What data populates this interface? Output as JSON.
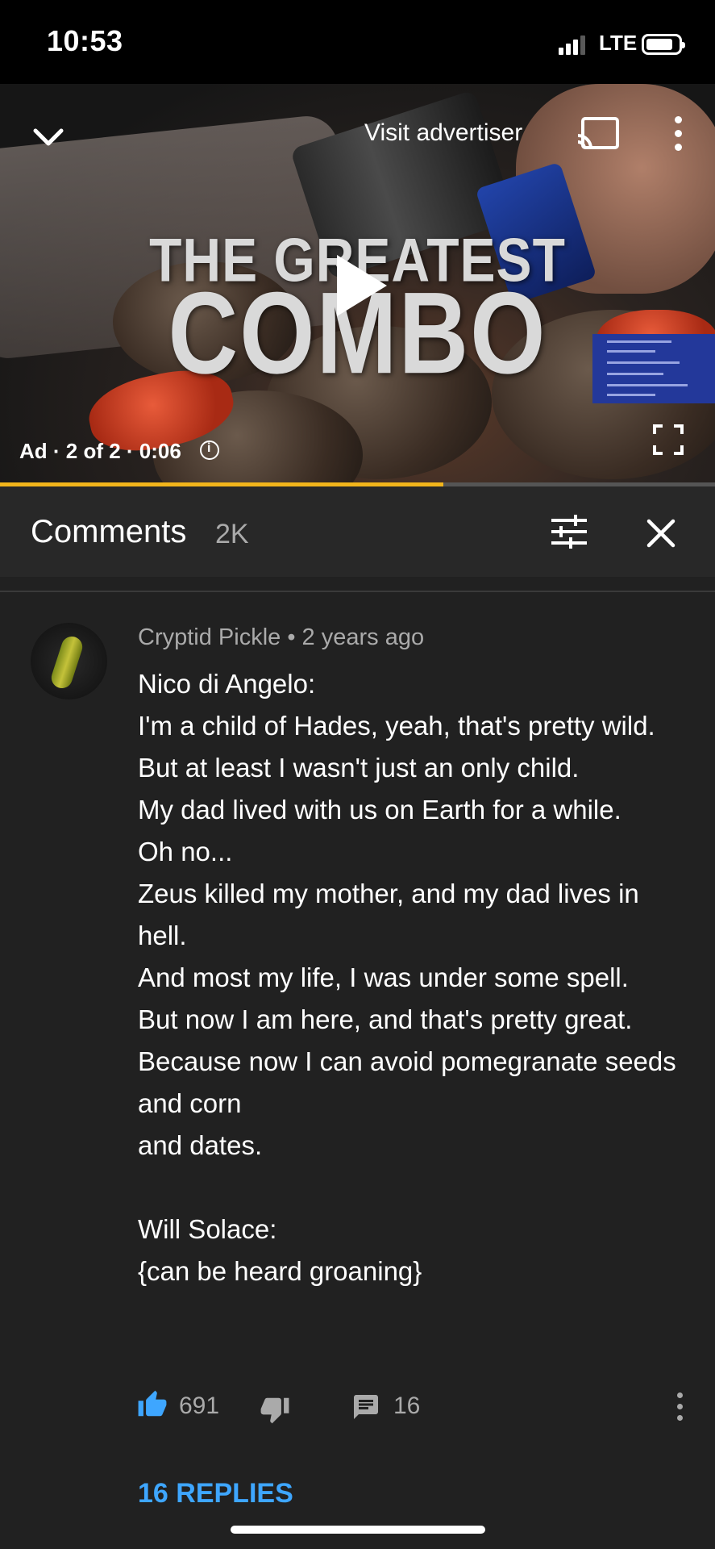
{
  "status_bar": {
    "time": "10:53",
    "network": "LTE"
  },
  "video": {
    "visit_advertiser": "Visit advertiser",
    "overlay_title_line1": "THE GREATEST",
    "overlay_title_line2": "COMBO",
    "ad_info": "Ad · 2 of 2 · 0:06",
    "progress_fraction": 0.62
  },
  "comments_header": {
    "title": "Comments",
    "count": "2K"
  },
  "comment": {
    "author": "Cryptid Pickle",
    "age": "2 years ago",
    "meta": "Cryptid Pickle • 2 years ago",
    "text": "Nico di Angelo:\nI'm a child of Hades, yeah, that's pretty wild.\nBut at least I wasn't just an only child.\nMy dad lived with us on Earth for a while.\nOh no...\nZeus killed my mother, and my dad lives in hell.\nAnd most my life, I was under some spell.\nBut now I am here, and that's pretty great.\nBecause now I can avoid pomegranate seeds\nand corn\nand dates.\n\nWill Solace:\n{can be heard groaning}",
    "likes": "691",
    "replies_count": "16",
    "replies_link": "16 REPLIES"
  },
  "colors": {
    "accent_blue": "#3ea6ff",
    "progress_yellow": "#f2b51b",
    "background": "#212121"
  }
}
